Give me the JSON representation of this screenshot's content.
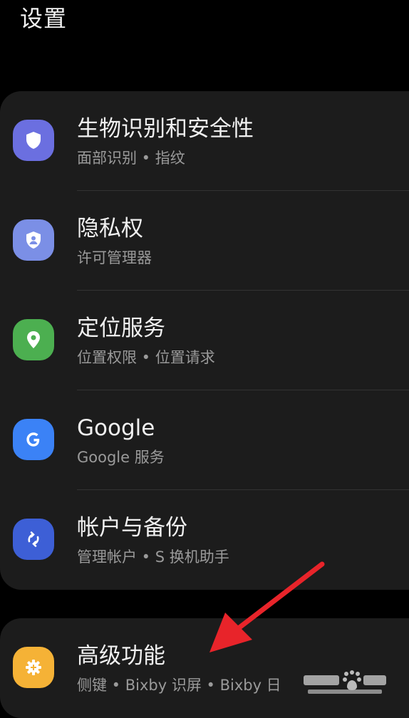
{
  "header": {
    "title": "设置"
  },
  "colors": {
    "background": "#000000",
    "card": "#1c1c1c",
    "security": "#6b6fe0",
    "privacy": "#7b8fe6",
    "location": "#4caf50",
    "google": "#3b82f6",
    "accounts": "#3d5fd6",
    "advanced": "#f5b236",
    "annotation_arrow": "#e8242a"
  },
  "settings": {
    "items": [
      {
        "title": "生物识别和安全性",
        "subtitle": "面部识别 • 指纹",
        "icon": "shield-icon"
      },
      {
        "title": "隐私权",
        "subtitle": "许可管理器",
        "icon": "privacy-shield-icon"
      },
      {
        "title": "定位服务",
        "subtitle": "位置权限 • 位置请求",
        "icon": "location-pin-icon"
      },
      {
        "title": "Google",
        "subtitle": "Google 服务",
        "icon": "google-icon"
      },
      {
        "title": "帐户与备份",
        "subtitle": "管理帐户 • S 换机助手",
        "icon": "sync-icon"
      }
    ],
    "advanced": {
      "title": "高级功能",
      "subtitle": "侧键 • Bixby 识屏 • Bixby 日",
      "icon": "gear-plus-icon"
    }
  },
  "watermark": {
    "icon": "baidu-jingyan-logo"
  }
}
